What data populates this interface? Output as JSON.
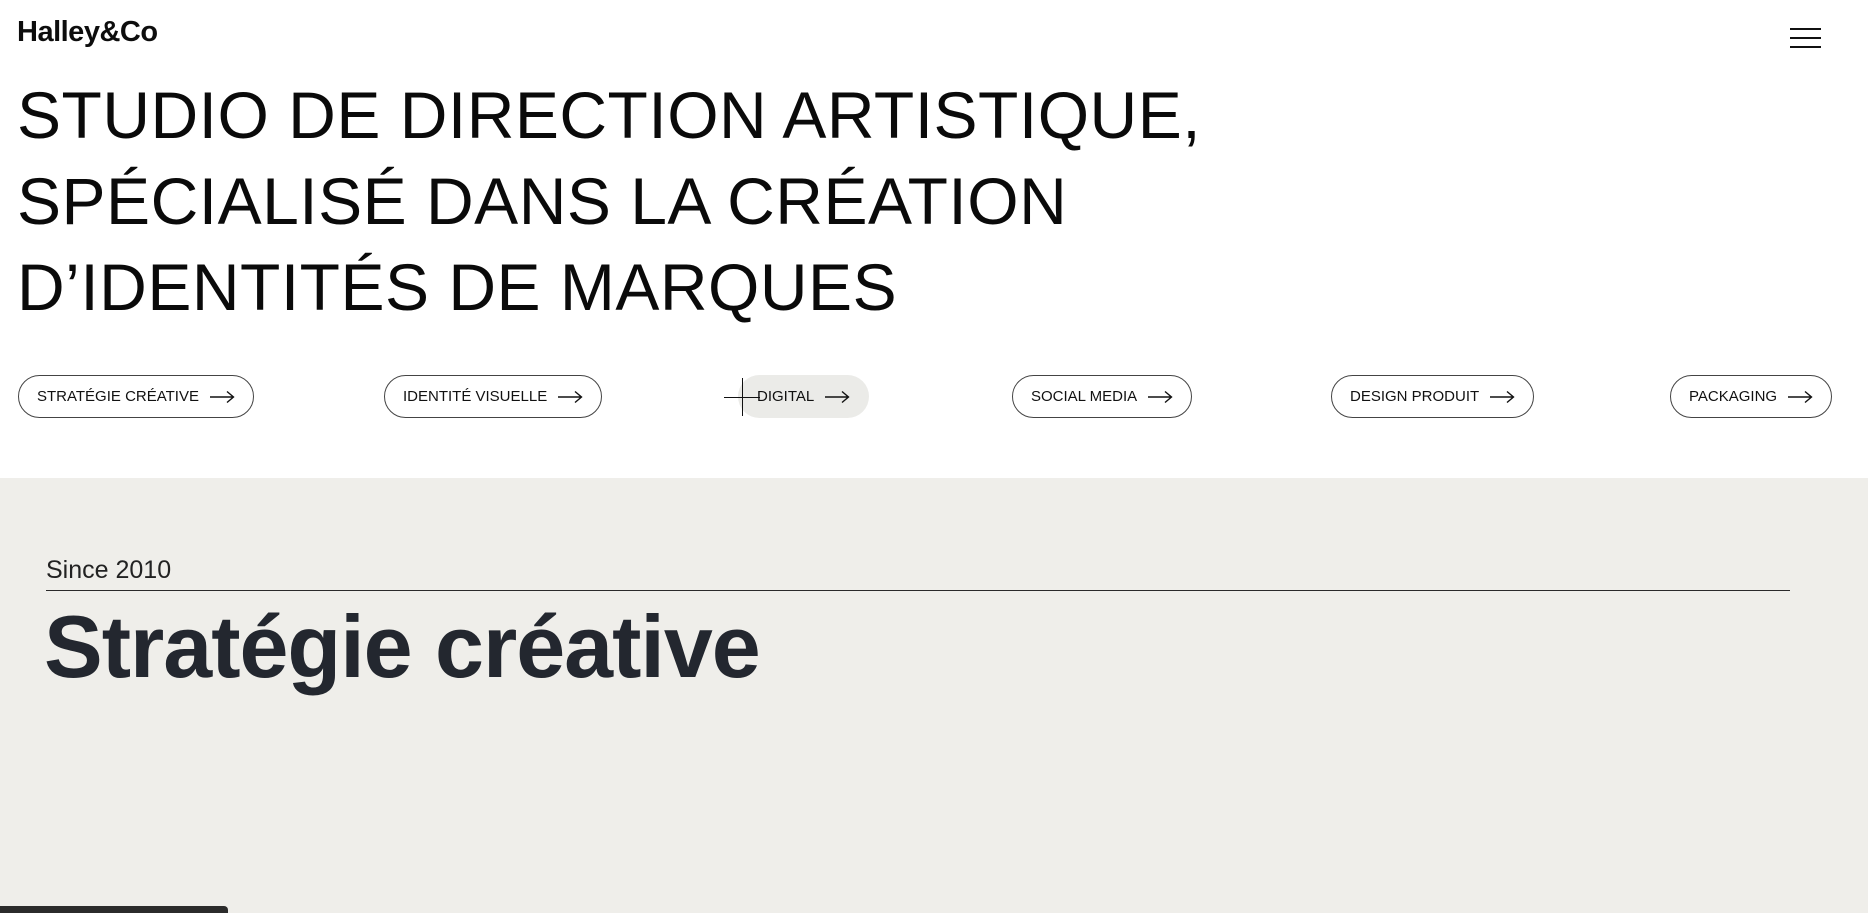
{
  "header": {
    "logo": "Halley&Co",
    "menu_icon": "hamburger-menu-icon"
  },
  "hero": {
    "lines": [
      "STUDIO DE DIRECTION ARTISTIQUE,",
      "SPÉCIALISÉ DANS LA CRÉATION",
      "D’IDENTITÉS DE MARQUES"
    ]
  },
  "services": [
    {
      "label": "STRATÉGIE CRÉATIVE",
      "icon": "arrow-right-icon"
    },
    {
      "label": "IDENTITÉ VISUELLE",
      "icon": "arrow-right-icon"
    },
    {
      "label": "DIGITAL",
      "icon": "arrow-right-icon",
      "state": "hover"
    },
    {
      "label": "SOCIAL MEDIA",
      "icon": "arrow-right-icon"
    },
    {
      "label": "DESIGN PRODUIT",
      "icon": "arrow-right-icon"
    },
    {
      "label": "PACKAGING",
      "icon": "arrow-right-icon"
    }
  ],
  "section": {
    "since": "Since 2010",
    "title": "Stratégie créative",
    "background_color": "#efeeea",
    "title_color": "#23272f"
  },
  "status_bar": {
    "text": ""
  }
}
